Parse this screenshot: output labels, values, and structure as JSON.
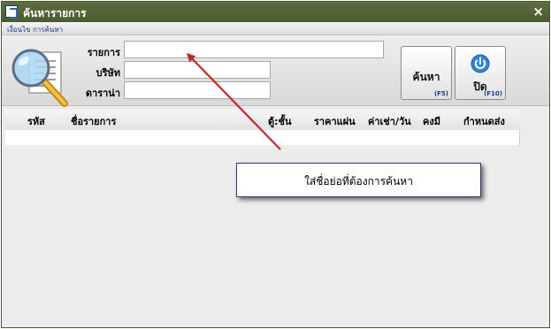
{
  "window": {
    "title": "ค้นหารายการ",
    "close_glyph": "×"
  },
  "subbar": {
    "text": "เงื่อนไข การค้นหา"
  },
  "form": {
    "item_label": "รายการ",
    "item_value": "",
    "company_label": "บริษัท",
    "company_value": "",
    "star_label": "ดาราน่า",
    "star_value": ""
  },
  "buttons": {
    "search_label": "ค้นหา",
    "search_key": "(F5)",
    "close_label": "ปิด",
    "close_key": "(F10)"
  },
  "grid": {
    "columns": [
      "รหัส",
      "ชื่อรายการ",
      "ตู้:ชั้น",
      "ราคาแผ่น",
      "ค่าเช่า/วัน",
      "คงมี",
      "กำหนดส่ง"
    ]
  },
  "tooltip": {
    "text": "ใส่ชื่อย่อที่ต้องการค้นหา"
  },
  "colors": {
    "titlebar": "#55663a",
    "arrow": "#c0282d",
    "accent_blue": "#1d3c8f"
  },
  "icons": [
    "window-app-icon",
    "close-icon",
    "magnifier-document-icon",
    "power-icon"
  ]
}
